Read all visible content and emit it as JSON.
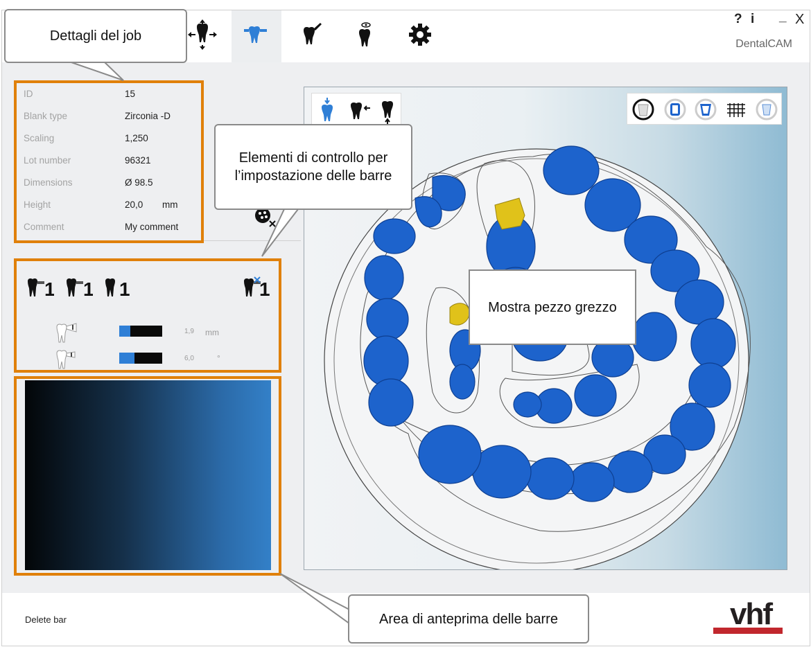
{
  "app": {
    "brand": "DentalCAM",
    "help_label": "?",
    "info_label": "i",
    "minimize_label": "_",
    "close_label": "X"
  },
  "toolbar": {
    "tools": [
      {
        "icon": "tooth-move-icon"
      },
      {
        "icon": "tooth-bar-icon",
        "active": true
      },
      {
        "icon": "tooth-tool-icon"
      },
      {
        "icon": "tooth-eye-icon"
      },
      {
        "icon": "gear-icon"
      }
    ]
  },
  "job_details": {
    "rows": [
      {
        "key": "ID",
        "value": "15",
        "unit": ""
      },
      {
        "key": "Blank type",
        "value": "Zirconia -D",
        "unit": ""
      },
      {
        "key": "Scaling",
        "value": "1,250",
        "unit": ""
      },
      {
        "key": "Lot number",
        "value": "96321",
        "unit": ""
      },
      {
        "key": "Dimensions",
        "value": "Ø 98.5",
        "unit": ""
      },
      {
        "key": "Height",
        "value": "20,0",
        "unit": "mm"
      },
      {
        "key": "Comment",
        "value": "My comment",
        "unit": ""
      }
    ]
  },
  "bar_controls": {
    "count_labels": [
      "1",
      "1",
      "1",
      "1"
    ],
    "thickness": {
      "value": "1,9",
      "unit": "mm",
      "level": 0.25
    },
    "angle": {
      "value": "6,0",
      "unit": "°",
      "level": 0.35
    }
  },
  "footer": {
    "delete_bar_label": "Delete bar",
    "logo_text": "vhf"
  },
  "callouts": {
    "job_details": "Dettagli del job",
    "bar_controls": "Elementi di controllo per l’impostazione delle barre",
    "show_blank": "Mostra pezzo grezzo",
    "bar_preview": "Area di anteprima delle barre"
  },
  "colors": {
    "accent_blue": "#2f7fd6",
    "highlight_orange": "#e0800a",
    "tooth_blue": "#1e63c8",
    "connector_yellow": "#e0c21a",
    "logo_red": "#c1272d"
  }
}
